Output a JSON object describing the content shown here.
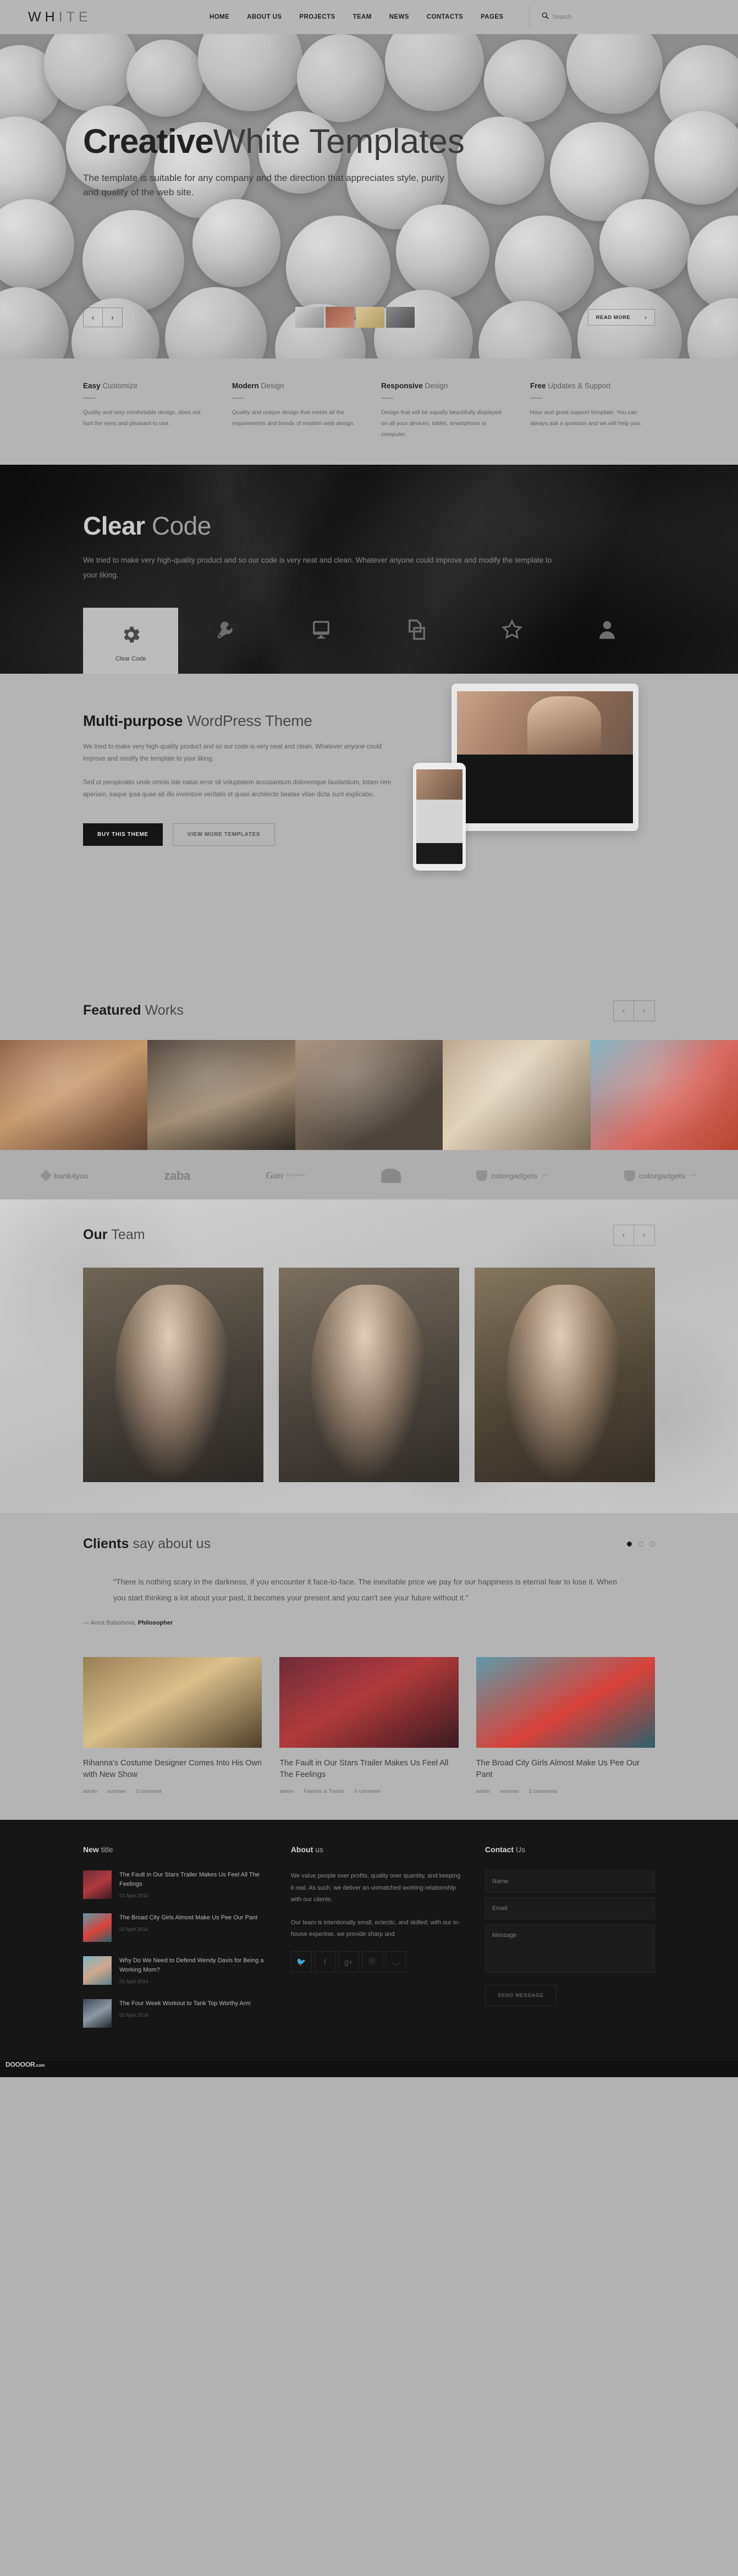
{
  "header": {
    "logo_main": "WH",
    "logo_dim": "ITE",
    "nav": [
      {
        "label": "HOME"
      },
      {
        "label": "ABOUT US"
      },
      {
        "label": "PROJECTS"
      },
      {
        "label": "TEAM"
      },
      {
        "label": "NEWS"
      },
      {
        "label": "CONTACTS"
      },
      {
        "label": "PAGES"
      }
    ],
    "search_placeholder": "Search"
  },
  "hero": {
    "title_bold": "Creative",
    "title_thin": "White Templates",
    "subtitle": "The template is suitable for any company and the direction that appreciates style, purity and quality of the web site.",
    "prev": "‹",
    "next": "›",
    "read_more": "READ MORE",
    "read_more_arrow": "›"
  },
  "features": [
    {
      "title_bold": "Easy",
      "title_thin": "Customize",
      "text": "Quality and very comfortable design, does not hurt the eyes and pleasant to use."
    },
    {
      "title_bold": "Modern",
      "title_thin": "Design",
      "text": "Quality and unique design that meets all the requirements and trends of modern web design."
    },
    {
      "title_bold": "Responsive",
      "title_thin": "Design",
      "text": "Design that will be equally beautifully displayed on all your devices, tablet, smartphone or computer."
    },
    {
      "title_bold": "Free",
      "title_thin": "Updates & Support",
      "text": "Hour and great support template. You can always ask a question and we will help you."
    }
  ],
  "clear_code": {
    "title_bold": "Clear",
    "title_thin": "Code",
    "text": "We tried to make very high-quality product and so our code is very neat and clean. Whatever anyone could improve and modify the template to your liking.",
    "icons": [
      {
        "name": "gear-icon",
        "label": "Clear Code",
        "active": true
      },
      {
        "name": "wrench-icon",
        "label": "",
        "active": false
      },
      {
        "name": "monitor-icon",
        "label": "",
        "active": false
      },
      {
        "name": "layers-icon",
        "label": "",
        "active": false
      },
      {
        "name": "star-icon",
        "label": "",
        "active": false
      },
      {
        "name": "user-icon",
        "label": "",
        "active": false
      }
    ]
  },
  "multipurpose": {
    "title_bold": "Multi-purpose",
    "title_thin": "WordPress Theme",
    "para1": "We tried to make very high-quality product and so our code is very neat and clean. Whatever anyone could improve and modify the template to your liking.",
    "para2": "Sed ut perspiciatis unde omnis iste natus error sit voluptatem accusantium doloremque laudantium, totam rem aperiam, eaque ipsa quae ab illo inventore veritatis et quasi architecto beatae vitae dicta sunt explicabo.",
    "buy_label": "BUY THIS THEME",
    "view_label": "VIEW MORE TEMPLATES"
  },
  "featured_works": {
    "title_bold": "Featured",
    "title_thin": "Works",
    "prev": "‹",
    "next": "›",
    "items": [
      {
        "name": "work-portrait-fur"
      },
      {
        "name": "work-portrait-dark"
      },
      {
        "name": "work-portrait-blonde"
      },
      {
        "name": "work-beach-hats"
      },
      {
        "name": "work-red-heart"
      }
    ]
  },
  "clients_logos": [
    {
      "text": "bank4you",
      "suffix": ".",
      "mark": "rhomb"
    },
    {
      "text": "zaba",
      "suffix": "·",
      "mark": "none"
    },
    {
      "text": "Gan",
      "suffix": "BELGRAVIA",
      "mark": "none"
    },
    {
      "text": "",
      "suffix": "",
      "mark": "hat"
    },
    {
      "text": "colorgadgets",
      "suffix": ".com",
      "mark": "shield"
    },
    {
      "text": "colorgadgets",
      "suffix": ".com",
      "mark": "shield"
    }
  ],
  "team": {
    "title_bold": "Our",
    "title_thin": "Team",
    "prev": "‹",
    "next": "›",
    "members": [
      {
        "name": "team-member-1"
      },
      {
        "name": "team-member-2"
      },
      {
        "name": "team-member-3"
      }
    ]
  },
  "clients": {
    "title_bold": "Clients",
    "title_thin": "say about us",
    "quote": "\"There is nothing scary in the darkness, if you encounter it face-to-face. The inevitable price we pay for our happiness is eternal fear to lose it. When you start thinking a lot about your past, it becomes your present and you can't see your future without it.\"",
    "author_prefix": "— Anna Balashova, ",
    "author_role": "Philosopher",
    "dots": [
      true,
      false,
      false
    ]
  },
  "blog": [
    {
      "title": "Rihanna's Costume Designer Comes Into His Own with New Show",
      "author": "admin",
      "category": "summer",
      "comments": "0 comment"
    },
    {
      "title": "The Fault in Our Stars Trailer Makes Us Feel All The Feelings",
      "author": "admin",
      "category": "Fashion & Trends",
      "comments": "0 comment"
    },
    {
      "title": "The Broad City Girls Almost Make Us Pee Our Pant",
      "author": "admin",
      "category": "summer",
      "comments": "2 comments"
    }
  ],
  "footer": {
    "news": {
      "title_bold": "New",
      "title_thin": "title",
      "items": [
        {
          "title": "The Fault in Our Stars Trailer Makes Us Feel All The Feelings",
          "date": "02 April 2014"
        },
        {
          "title": "The Broad City Girls Almost Make Us Pee Our Pant",
          "date": "02 April 2014"
        },
        {
          "title": "Why Do We Need to Defend Wendy Davis for Being a Working Mom?",
          "date": "02 April 2014"
        },
        {
          "title": "The Four Week Workout to Tank Top Worthy Arm",
          "date": "02 April 2014"
        }
      ]
    },
    "about": {
      "title_bold": "About",
      "title_thin": "us",
      "para1": "We value people over profits, quality over quantity, and keeping it real. As such, we deliver an unmatched working relationship with our clients.",
      "para2": "Our team is intentionally small, eclectic, and skilled; with our in-house expertise, we provide sharp and",
      "socials": [
        {
          "name": "twitter-icon",
          "glyph": "🐦"
        },
        {
          "name": "facebook-icon",
          "glyph": "f"
        },
        {
          "name": "google-plus-icon",
          "glyph": "g+"
        },
        {
          "name": "pinterest-icon",
          "glyph": "Ⓟ"
        },
        {
          "name": "rss-icon",
          "glyph": "◡"
        }
      ]
    },
    "contact": {
      "title_bold": "Contact",
      "title_thin": "Us",
      "name_placeholder": "Name",
      "email_placeholder": "Email",
      "message_placeholder": "Message",
      "send_label": "SEND MESSAGE"
    }
  },
  "watermark": {
    "text": "DOOOOR",
    "suffix": ".com"
  },
  "colors": {
    "page_bg": "#b4b4b4",
    "dark_bg": "#161616",
    "accent_dark": "#1c1c1c",
    "muted_text": "#5f5f5f"
  }
}
